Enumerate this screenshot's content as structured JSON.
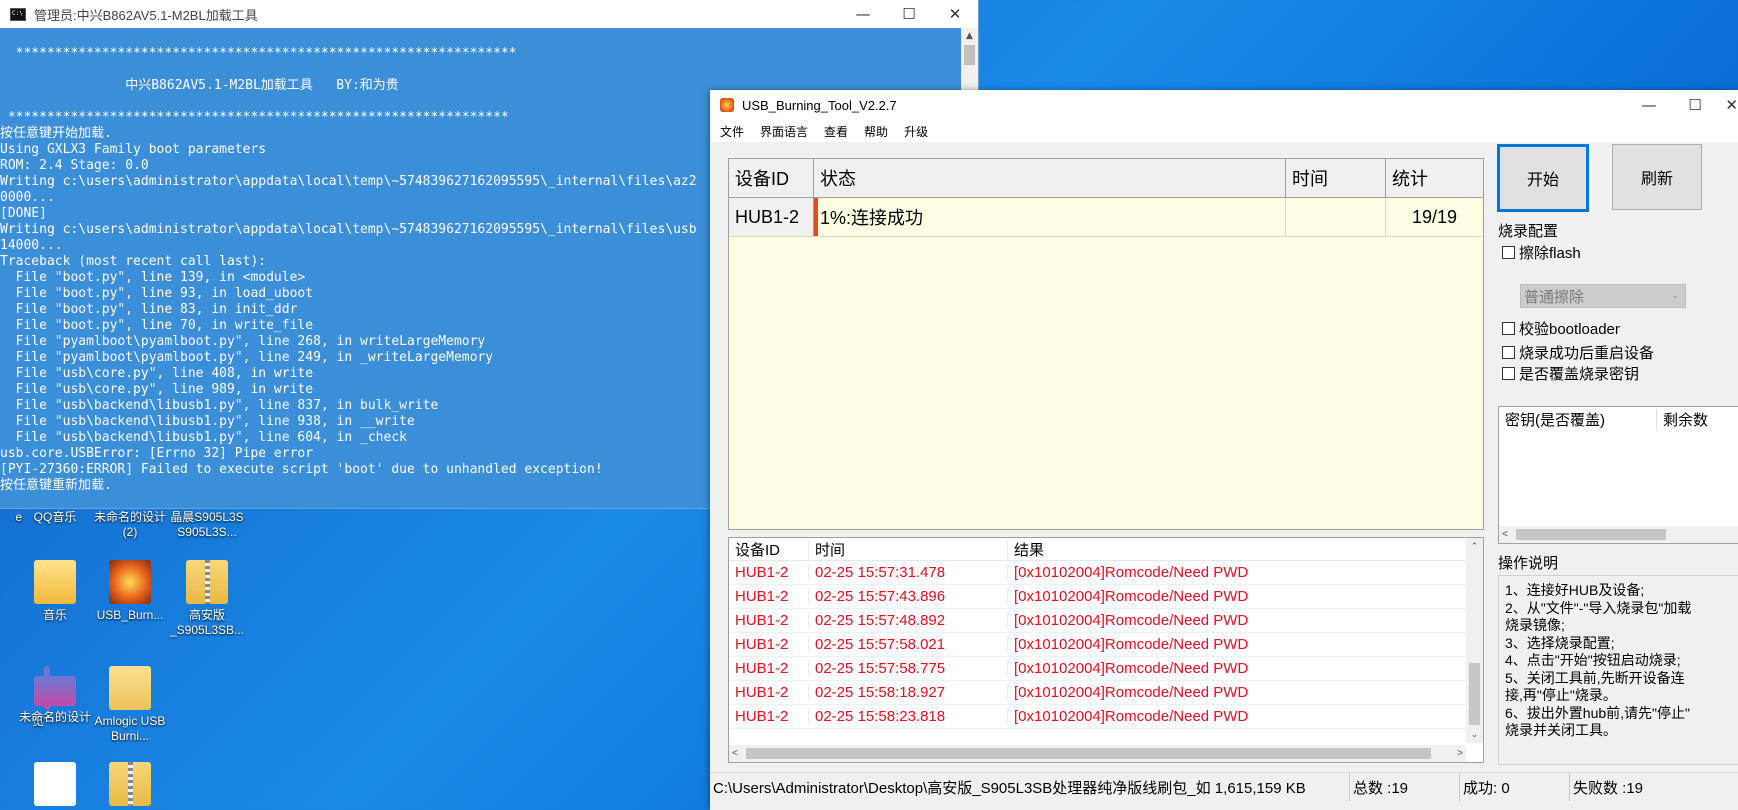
{
  "console": {
    "title": "管理员:中兴B862AV5.1-M2BL加载工具",
    "lines": [
      "  ****************************************************************",
      "",
      "                中兴B862AV5.1-M2BL加载工具   BY:和为贵",
      "",
      " ****************************************************************",
      "按任意键开始加载.",
      "Using GXLX3 Family boot parameters",
      "ROM: 2.4 Stage: 0.0",
      "Writing c:\\users\\administrator\\appdata\\local\\temp\\~574839627162095595\\_internal\\files\\az2",
      "0000...",
      "[DONE]",
      "Writing c:\\users\\administrator\\appdata\\local\\temp\\~574839627162095595\\_internal\\files\\usb",
      "14000...",
      "Traceback (most recent call last):",
      "  File \"boot.py\", line 139, in <module>",
      "  File \"boot.py\", line 93, in load_uboot",
      "  File \"boot.py\", line 83, in init_ddr",
      "  File \"boot.py\", line 70, in write_file",
      "  File \"pyamlboot\\pyamlboot.py\", line 268, in writeLargeMemory",
      "  File \"pyamlboot\\pyamlboot.py\", line 249, in _writeLargeMemory",
      "  File \"usb\\core.py\", line 408, in write",
      "  File \"usb\\core.py\", line 989, in write",
      "  File \"usb\\backend\\libusb1.py\", line 837, in bulk_write",
      "  File \"usb\\backend\\libusb1.py\", line 938, in __write",
      "  File \"usb\\backend\\libusb1.py\", line 604, in _check",
      "usb.core.USBError: [Errno 32] Pipe error",
      "[PYI-27360:ERROR] Failed to execute script 'boot' due to unhandled exception!",
      "按任意键重新加载."
    ]
  },
  "desktop": {
    "row1": [
      {
        "label": "e",
        "icon": "app-icon"
      },
      {
        "label": "QQ音乐",
        "icon": "qq-music-icon"
      },
      {
        "label": "未命名的设计 (2)",
        "icon": "design-icon"
      },
      {
        "label": "晶晨S905L3S S905L3S...",
        "icon": "zip-folder-icon"
      }
    ],
    "row2": [
      {
        "label": "音乐",
        "icon": "music-folder-icon"
      },
      {
        "label": "USB_Burn...",
        "icon": "amlogic-tool-icon"
      },
      {
        "label": "高安版 _S905L3SB...",
        "icon": "zip-folder-icon"
      }
    ],
    "row3": [
      {
        "label": "览",
        "icon": "app-icon"
      },
      {
        "label": "未命名的设计",
        "icon": "design-icon"
      },
      {
        "label": "Amlogic USB Burni...",
        "icon": "folder-icon"
      }
    ]
  },
  "usbtool": {
    "title": "USB_Burning_Tool_V2.2.7",
    "menu": [
      "文件",
      "界面语言",
      "查看",
      "帮助",
      "升级"
    ],
    "device_headers": [
      "设备ID",
      "状态",
      "时间",
      "统计"
    ],
    "device_rows": [
      {
        "id": "HUB1-2",
        "status": "1%:连接成功",
        "time": "",
        "stat": "19/19",
        "progress": 0.01
      }
    ],
    "log_headers": [
      "设备ID",
      "时间",
      "结果"
    ],
    "log_rows": [
      {
        "id": "HUB1-2",
        "time": "02-25 15:57:31.478",
        "result": "[0x10102004]Romcode/Need PWD"
      },
      {
        "id": "HUB1-2",
        "time": "02-25 15:57:43.896",
        "result": "[0x10102004]Romcode/Need PWD"
      },
      {
        "id": "HUB1-2",
        "time": "02-25 15:57:48.892",
        "result": "[0x10102004]Romcode/Need PWD"
      },
      {
        "id": "HUB1-2",
        "time": "02-25 15:57:58.021",
        "result": "[0x10102004]Romcode/Need PWD"
      },
      {
        "id": "HUB1-2",
        "time": "02-25 15:57:58.775",
        "result": "[0x10102004]Romcode/Need PWD"
      },
      {
        "id": "HUB1-2",
        "time": "02-25 15:58:18.927",
        "result": "[0x10102004]Romcode/Need PWD"
      },
      {
        "id": "HUB1-2",
        "time": "02-25 15:58:23.818",
        "result": "[0x10102004]Romcode/Need PWD"
      }
    ],
    "start_label": "开始",
    "refresh_label": "刷新",
    "burn_config_title": "烧录配置",
    "erase_flash": "擦除flash",
    "erase_mode": "普通擦除",
    "verify_bootloader": "校验bootloader",
    "reboot_after": "烧录成功后重启设备",
    "overwrite_key": "是否覆盖烧录密钥",
    "key_headers": [
      "密钥(是否覆盖)",
      "剩余数"
    ],
    "instructions_title": "操作说明",
    "instructions": [
      "1、连接好HUB及设备;",
      "2、从\"文件\"-\"导入烧录包\"加载",
      "烧录镜像;",
      "3、选择烧录配置;",
      "4、点击\"开始\"按钮启动烧录;",
      "5、关闭工具前,先断开设备连",
      "接,再\"停止\"烧录。",
      "6、拔出外置hub前,请先\"停止\"",
      "烧录并关闭工具。"
    ],
    "status": {
      "path": "C:\\Users\\Administrator\\Desktop\\高安版_S905L3SB处理器纯净版线刷包_如 1,615,159 KB",
      "total": "总数 :19",
      "success": "成功: 0",
      "fail": "失败数 :19"
    }
  },
  "colors": {
    "console_bg": "#3b8fd9",
    "log_error": "#e0101c",
    "device_bg": "#fffde2"
  }
}
